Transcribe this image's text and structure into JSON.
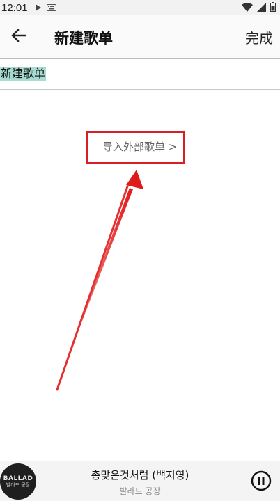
{
  "status_bar": {
    "time": "12:01",
    "icons": [
      "play-indicator-icon",
      "keyboard-icon",
      "wifi-icon",
      "signal-icon",
      "battery-icon"
    ]
  },
  "toolbar": {
    "back_icon": "arrow-left-icon",
    "title": "新建歌单",
    "done_label": "完成"
  },
  "form": {
    "name_value": "新建歌单"
  },
  "import": {
    "label": "导入外部歌单 >"
  },
  "annotation": {
    "highlight_color": "#d81f26"
  },
  "player": {
    "album_art_text_1": "BALLAD",
    "album_art_text_2": "발라드 공장",
    "song_title": "총맞은것처럼 (백지영)",
    "artist": "발라드 공장",
    "pause_icon": "pause-icon"
  }
}
